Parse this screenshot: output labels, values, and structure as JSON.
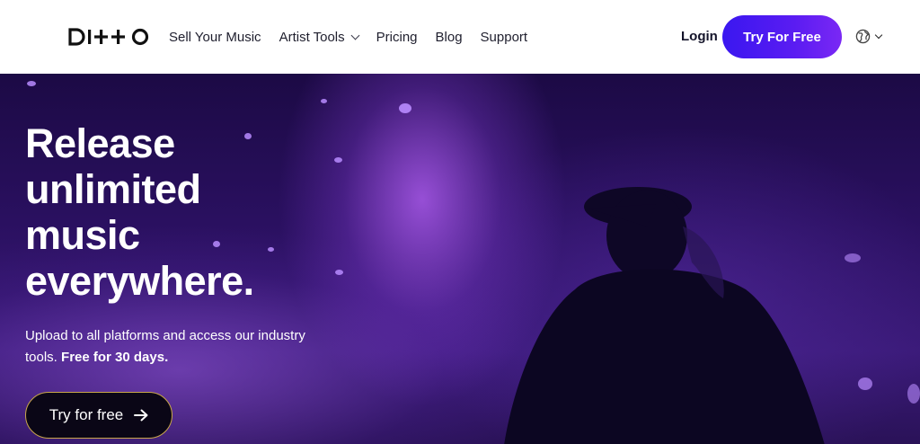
{
  "nav": {
    "logo_text": "DITTO",
    "items": [
      {
        "label": "Sell Your Music",
        "has_dropdown": false
      },
      {
        "label": "Artist Tools",
        "has_dropdown": true
      },
      {
        "label": "Pricing",
        "has_dropdown": false
      },
      {
        "label": "Blog",
        "has_dropdown": false
      },
      {
        "label": "Support",
        "has_dropdown": false
      }
    ],
    "login_label": "Login",
    "cta_label": "Try For Free",
    "language_icon": "globe-icon"
  },
  "hero": {
    "title_lines": [
      "Release",
      "unlimited",
      "music",
      "everywhere."
    ],
    "subtitle_main": "Upload to all platforms and access our industry tools.",
    "subtitle_bold": "Free for 30 days.",
    "button_label": "Try for free",
    "button_icon": "arrow-right-icon"
  },
  "colors": {
    "accent": "#4b1cf0",
    "hero_bg": "#2a1060",
    "button_border": "#c9a64a"
  }
}
